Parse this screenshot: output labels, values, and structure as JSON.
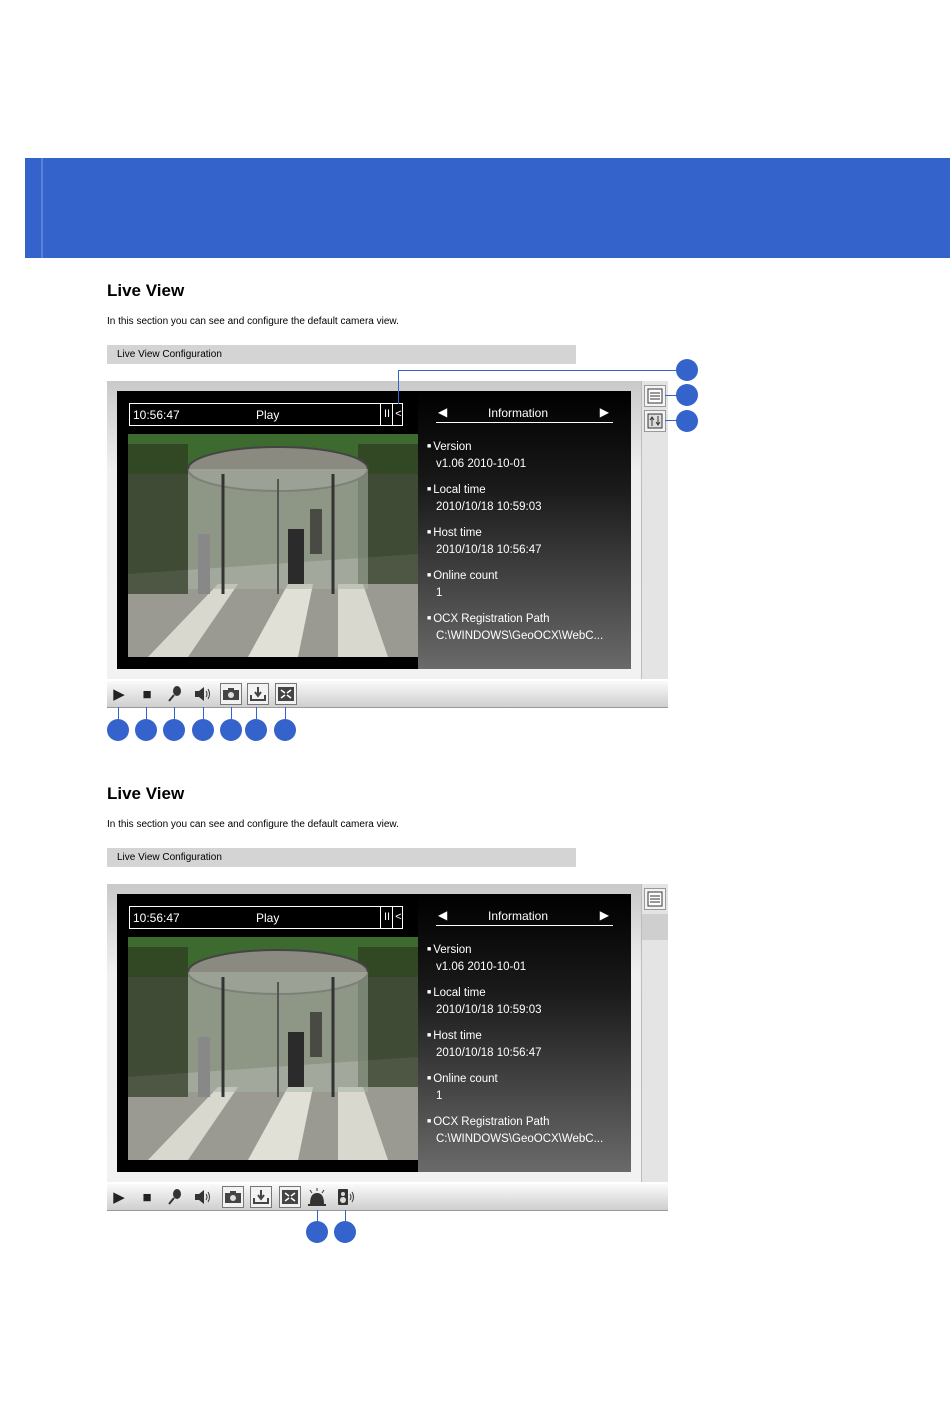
{
  "accent_color": "#3563cc",
  "sections": [
    {
      "title": "Live View",
      "description": "In this section you can see and configure the default camera view.",
      "config_bar": "Live View Configuration",
      "osd": {
        "time": "10:56:47",
        "state": "Play",
        "pause_glyph": "II",
        "collapse_glyph": "<"
      },
      "info": {
        "header": "Information",
        "prev_glyph": "◀",
        "next_glyph": "▶",
        "items": [
          {
            "label": "Version",
            "value": "v1.06  2010-10-01"
          },
          {
            "label": "Local time",
            "value": "2010/10/18 10:59:03"
          },
          {
            "label": "Host time",
            "value": "2010/10/18 10:56:47"
          },
          {
            "label": "Online count",
            "value": "1"
          },
          {
            "label": "OCX Registration Path",
            "value": "C:\\WINDOWS\\GeoOCX\\WebC..."
          }
        ]
      },
      "toolbar_icons": [
        "play-icon",
        "stop-icon",
        "microphone-icon",
        "speaker-icon",
        "snapshot-icon",
        "record-icon",
        "fullscreen-icon"
      ],
      "side_icons": [
        "info-panel-icon",
        "ptz-panel-icon"
      ]
    },
    {
      "title": "Live View",
      "description": "In this section you can see and configure the default camera view.",
      "config_bar": "Live View Configuration",
      "osd": {
        "time": "10:56:47",
        "state": "Play",
        "pause_glyph": "II",
        "collapse_glyph": "<"
      },
      "info": {
        "header": "Information",
        "prev_glyph": "◀",
        "next_glyph": "▶",
        "items": [
          {
            "label": "Version",
            "value": "v1.06  2010-10-01"
          },
          {
            "label": "Local time",
            "value": "2010/10/18 10:59:03"
          },
          {
            "label": "Host time",
            "value": "2010/10/18 10:56:47"
          },
          {
            "label": "Online count",
            "value": "1"
          },
          {
            "label": "OCX Registration Path",
            "value": "C:\\WINDOWS\\GeoOCX\\WebC..."
          }
        ]
      },
      "toolbar_icons": [
        "play-icon",
        "stop-icon",
        "microphone-icon",
        "speaker-icon",
        "snapshot-icon",
        "record-icon",
        "fullscreen-icon",
        "alarm-icon",
        "audio-output-icon"
      ],
      "side_icons": [
        "info-panel-icon"
      ]
    }
  ]
}
